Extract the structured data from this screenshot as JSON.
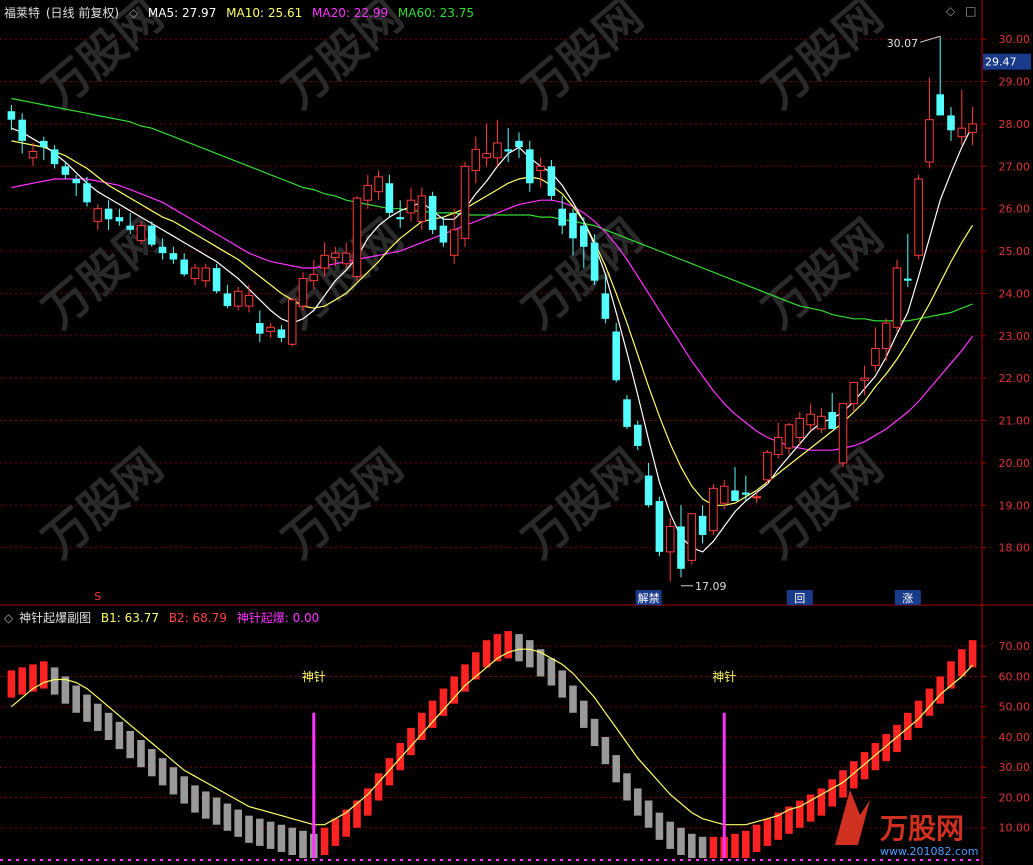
{
  "colors": {
    "background": "#000000",
    "grid": "#7a0000",
    "up": "#ff3b3b",
    "down": "#54ffff",
    "ma5": "#ffffff",
    "ma10": "#ffff66",
    "ma20": "#ff33ff",
    "ma60": "#33dd33",
    "b1": "#ffff66",
    "bar_up": "#ff2222",
    "bar_down": "#999999",
    "needle": "#ff33ff",
    "signal_text": "#ffff66"
  },
  "main_header": {
    "title": "福莱特",
    "mode": "(日线 前复权)",
    "ma5": "MA5: 27.97",
    "ma10": "MA10: 25.61",
    "ma20": "MA20: 22.99",
    "ma60": "MA60: 23.75"
  },
  "sub_header": {
    "title": "神针起爆副图",
    "b1": "B1: 63.77",
    "b2": "B2: 68.79",
    "burst": "神针起爆: 0.00"
  },
  "price_axis": {
    "ticks": [
      "30.00",
      "29.00",
      "28.00",
      "27.00",
      "26.00",
      "25.00",
      "24.00",
      "23.00",
      "22.00",
      "21.00",
      "20.00",
      "19.00",
      "18.00"
    ],
    "current": "29.47"
  },
  "sub_axis": {
    "ticks": [
      "70.00",
      "60.00",
      "50.00",
      "40.00",
      "30.00",
      "20.00",
      "10.00"
    ]
  },
  "annotations": {
    "high": "30.07",
    "low": "17.09",
    "marker_left": "S",
    "tag1": "解禁",
    "tag2": "回",
    "tag3": "涨",
    "needle1": "神针",
    "needle2": "神针"
  },
  "watermark": {
    "brand": "万股网",
    "url": "www.201082.com"
  },
  "chart_data": {
    "type": "candlestick",
    "ohlc": [
      [
        28.3,
        28.45,
        27.85,
        28.1
      ],
      [
        28.1,
        28.25,
        27.3,
        27.6
      ],
      [
        27.2,
        27.55,
        27.0,
        27.35
      ],
      [
        27.6,
        27.7,
        27.15,
        27.45
      ],
      [
        27.4,
        27.5,
        26.95,
        27.05
      ],
      [
        27.0,
        27.1,
        26.7,
        26.8
      ],
      [
        26.7,
        26.8,
        26.3,
        26.6
      ],
      [
        26.6,
        26.75,
        26.05,
        26.15
      ],
      [
        25.7,
        26.1,
        25.5,
        26.0
      ],
      [
        26.0,
        26.2,
        25.5,
        25.75
      ],
      [
        25.8,
        26.0,
        25.6,
        25.7
      ],
      [
        25.6,
        25.9,
        25.4,
        25.5
      ],
      [
        25.25,
        25.7,
        25.15,
        25.6
      ],
      [
        25.6,
        25.7,
        25.1,
        25.15
      ],
      [
        25.1,
        25.3,
        24.8,
        24.95
      ],
      [
        24.95,
        25.1,
        24.7,
        24.8
      ],
      [
        24.8,
        24.95,
        24.4,
        24.45
      ],
      [
        24.35,
        24.7,
        24.2,
        24.6
      ],
      [
        24.3,
        24.7,
        24.15,
        24.6
      ],
      [
        24.6,
        24.7,
        24.0,
        24.05
      ],
      [
        24.0,
        24.2,
        23.65,
        23.7
      ],
      [
        23.7,
        24.15,
        23.6,
        24.05
      ],
      [
        23.7,
        24.2,
        23.55,
        23.95
      ],
      [
        23.3,
        23.6,
        22.85,
        23.05
      ],
      [
        23.1,
        23.3,
        22.95,
        23.2
      ],
      [
        23.15,
        23.25,
        22.85,
        22.95
      ],
      [
        22.8,
        23.9,
        22.75,
        23.85
      ],
      [
        23.7,
        24.5,
        23.6,
        24.35
      ],
      [
        24.3,
        24.8,
        24.1,
        24.45
      ],
      [
        24.6,
        25.2,
        24.4,
        24.9
      ],
      [
        24.85,
        25.1,
        24.65,
        24.95
      ],
      [
        24.7,
        25.2,
        24.6,
        24.95
      ],
      [
        24.4,
        26.3,
        24.3,
        26.25
      ],
      [
        26.2,
        26.8,
        26.0,
        26.55
      ],
      [
        26.4,
        26.9,
        26.2,
        26.75
      ],
      [
        26.6,
        26.8,
        25.8,
        25.9
      ],
      [
        25.8,
        26.2,
        25.55,
        25.75
      ],
      [
        25.9,
        26.5,
        25.7,
        26.2
      ],
      [
        25.7,
        26.5,
        25.5,
        26.3
      ],
      [
        26.3,
        26.4,
        25.4,
        25.5
      ],
      [
        25.6,
        25.8,
        25.1,
        25.2
      ],
      [
        24.9,
        26.0,
        24.7,
        25.5
      ],
      [
        25.3,
        27.1,
        25.1,
        27.0
      ],
      [
        26.9,
        27.7,
        26.6,
        27.4
      ],
      [
        27.2,
        28.0,
        27.0,
        27.3
      ],
      [
        27.2,
        28.1,
        27.0,
        27.55
      ],
      [
        27.4,
        27.9,
        27.1,
        27.35
      ],
      [
        27.6,
        27.8,
        27.2,
        27.45
      ],
      [
        27.4,
        27.6,
        26.4,
        26.6
      ],
      [
        26.9,
        27.2,
        26.5,
        27.0
      ],
      [
        27.0,
        27.15,
        26.2,
        26.3
      ],
      [
        26.0,
        26.3,
        25.4,
        25.6
      ],
      [
        25.9,
        26.0,
        24.9,
        25.3
      ],
      [
        25.6,
        25.8,
        24.6,
        25.1
      ],
      [
        25.2,
        25.4,
        24.2,
        24.3
      ],
      [
        24.0,
        24.4,
        23.3,
        23.4
      ],
      [
        23.1,
        23.3,
        21.9,
        21.95
      ],
      [
        21.5,
        21.6,
        20.8,
        20.85
      ],
      [
        20.9,
        21.0,
        20.3,
        20.4
      ],
      [
        19.7,
        20.0,
        18.95,
        19.0
      ],
      [
        19.1,
        19.2,
        17.8,
        17.9
      ],
      [
        17.9,
        18.7,
        17.2,
        18.5
      ],
      [
        18.5,
        19.0,
        17.3,
        17.5
      ],
      [
        17.7,
        18.8,
        17.6,
        18.8
      ],
      [
        18.75,
        19.0,
        18.1,
        18.3
      ],
      [
        18.4,
        19.5,
        18.3,
        19.4
      ],
      [
        19.05,
        19.6,
        18.9,
        19.45
      ],
      [
        19.35,
        19.9,
        19.1,
        19.1
      ],
      [
        19.3,
        19.7,
        19.1,
        19.25
      ],
      [
        19.2,
        19.3,
        19.05,
        19.2
      ],
      [
        19.6,
        20.3,
        19.5,
        20.25
      ],
      [
        20.2,
        20.95,
        20.1,
        20.6
      ],
      [
        20.35,
        20.95,
        20.2,
        20.9
      ],
      [
        20.6,
        21.2,
        20.4,
        21.05
      ],
      [
        20.9,
        21.4,
        20.75,
        21.15
      ],
      [
        20.8,
        21.3,
        20.7,
        21.1
      ],
      [
        21.2,
        21.65,
        20.8,
        20.8
      ],
      [
        20.0,
        21.4,
        19.9,
        21.4
      ],
      [
        21.4,
        21.9,
        21.2,
        21.9
      ],
      [
        21.95,
        22.3,
        21.6,
        22.0
      ],
      [
        22.3,
        23.2,
        22.15,
        22.7
      ],
      [
        22.7,
        23.4,
        22.4,
        23.3
      ],
      [
        23.2,
        24.8,
        23.1,
        24.6
      ],
      [
        24.35,
        25.4,
        24.15,
        24.3
      ],
      [
        24.9,
        26.8,
        24.8,
        26.7
      ],
      [
        27.1,
        29.1,
        26.95,
        28.1
      ],
      [
        28.7,
        30.07,
        28.5,
        28.2
      ],
      [
        28.2,
        28.4,
        27.6,
        27.85
      ],
      [
        27.7,
        28.8,
        27.5,
        27.9
      ],
      [
        27.8,
        28.4,
        27.5,
        28.0
      ]
    ],
    "ma5": [
      27.9,
      27.8,
      27.65,
      27.5,
      27.3,
      27.1,
      26.85,
      26.6,
      26.4,
      26.25,
      26.1,
      25.95,
      25.8,
      25.65,
      25.5,
      25.35,
      25.2,
      25.05,
      24.9,
      24.75,
      24.55,
      24.35,
      24.1,
      23.85,
      23.6,
      23.4,
      23.3,
      23.4,
      23.6,
      23.95,
      24.3,
      24.55,
      24.85,
      25.3,
      25.6,
      25.8,
      25.95,
      26.05,
      26.15,
      25.95,
      25.75,
      25.75,
      26.0,
      26.35,
      26.65,
      27.0,
      27.3,
      27.45,
      27.2,
      27.0,
      26.85,
      26.55,
      26.15,
      25.7,
      25.15,
      24.45,
      23.55,
      22.6,
      21.6,
      20.55,
      19.55,
      18.8,
      18.25,
      18.0,
      17.9,
      18.15,
      18.5,
      18.85,
      19.1,
      19.3,
      19.5,
      19.85,
      20.15,
      20.45,
      20.75,
      20.95,
      21.05,
      21.2,
      21.45,
      21.75,
      22.05,
      22.5,
      23.05,
      23.55,
      24.4,
      25.3,
      26.2,
      26.85,
      27.45,
      27.97
    ],
    "ma10": [
      27.6,
      27.55,
      27.5,
      27.45,
      27.35,
      27.25,
      27.1,
      26.95,
      26.75,
      26.55,
      26.4,
      26.25,
      26.1,
      25.95,
      25.8,
      25.7,
      25.55,
      25.4,
      25.25,
      25.1,
      24.95,
      24.8,
      24.6,
      24.4,
      24.2,
      24.0,
      23.85,
      23.7,
      23.65,
      23.7,
      23.85,
      24.0,
      24.25,
      24.5,
      24.75,
      25.05,
      25.3,
      25.5,
      25.7,
      25.75,
      25.8,
      25.9,
      26.0,
      26.15,
      26.3,
      26.45,
      26.6,
      26.7,
      26.75,
      26.7,
      26.55,
      26.35,
      26.05,
      25.7,
      25.2,
      24.65,
      24.0,
      23.3,
      22.55,
      21.8,
      21.1,
      20.45,
      19.9,
      19.45,
      19.15,
      19.0,
      19.0,
      19.05,
      19.2,
      19.35,
      19.55,
      19.75,
      19.95,
      20.15,
      20.35,
      20.55,
      20.75,
      20.95,
      21.2,
      21.45,
      21.8,
      22.1,
      22.45,
      22.85,
      23.3,
      23.75,
      24.25,
      24.75,
      25.2,
      25.61
    ],
    "ma20": [
      26.5,
      26.55,
      26.6,
      26.65,
      26.7,
      26.7,
      26.7,
      26.7,
      26.65,
      26.6,
      26.55,
      26.45,
      26.35,
      26.25,
      26.15,
      26.0,
      25.85,
      25.7,
      25.55,
      25.4,
      25.25,
      25.1,
      24.95,
      24.85,
      24.75,
      24.7,
      24.65,
      24.6,
      24.6,
      24.65,
      24.7,
      24.75,
      24.8,
      24.85,
      24.9,
      24.95,
      25.0,
      25.1,
      25.2,
      25.3,
      25.4,
      25.5,
      25.6,
      25.7,
      25.8,
      25.9,
      26.0,
      26.1,
      26.15,
      26.2,
      26.2,
      26.15,
      26.05,
      25.9,
      25.7,
      25.45,
      25.15,
      24.8,
      24.4,
      24.0,
      23.6,
      23.2,
      22.8,
      22.4,
      22.05,
      21.7,
      21.4,
      21.15,
      20.95,
      20.75,
      20.6,
      20.5,
      20.4,
      20.35,
      20.3,
      20.3,
      20.3,
      20.35,
      20.4,
      20.5,
      20.65,
      20.8,
      21.0,
      21.2,
      21.45,
      21.75,
      22.05,
      22.35,
      22.65,
      22.99
    ],
    "ma60": [
      28.6,
      28.55,
      28.5,
      28.45,
      28.4,
      28.35,
      28.3,
      28.25,
      28.2,
      28.15,
      28.1,
      28.05,
      27.95,
      27.9,
      27.8,
      27.7,
      27.6,
      27.5,
      27.4,
      27.3,
      27.2,
      27.1,
      27.0,
      26.9,
      26.8,
      26.7,
      26.6,
      26.5,
      26.45,
      26.35,
      26.3,
      26.2,
      26.15,
      26.1,
      26.05,
      26.0,
      26.0,
      25.95,
      25.95,
      25.9,
      25.9,
      25.9,
      25.85,
      25.85,
      25.85,
      25.85,
      25.85,
      25.85,
      25.85,
      25.8,
      25.8,
      25.75,
      25.7,
      25.65,
      25.6,
      25.5,
      25.4,
      25.3,
      25.2,
      25.1,
      25.0,
      24.9,
      24.8,
      24.7,
      24.6,
      24.5,
      24.4,
      24.3,
      24.2,
      24.1,
      24.0,
      23.9,
      23.8,
      23.7,
      23.65,
      23.6,
      23.5,
      23.45,
      23.4,
      23.4,
      23.35,
      23.35,
      23.35,
      23.35,
      23.4,
      23.45,
      23.5,
      23.55,
      23.65,
      23.75
    ],
    "sub_bars": [
      62,
      63,
      64,
      65,
      63,
      60,
      57,
      54,
      51,
      48,
      45,
      42,
      39,
      36,
      33,
      30,
      27,
      24,
      22,
      20,
      18,
      16,
      14,
      13,
      12,
      11,
      10,
      9,
      8,
      10,
      13,
      16,
      19,
      23,
      28,
      33,
      38,
      43,
      48,
      52,
      56,
      60,
      64,
      68,
      72,
      74,
      75,
      74,
      72,
      69,
      66,
      62,
      57,
      52,
      46,
      40,
      34,
      28,
      23,
      19,
      15,
      12,
      10,
      8,
      7,
      7,
      7,
      8,
      9,
      11,
      13,
      15,
      17,
      19,
      21,
      23,
      26,
      29,
      32,
      35,
      38,
      41,
      44,
      48,
      52,
      56,
      60,
      65,
      69,
      72
    ],
    "b1_line": [
      50,
      53,
      56,
      58,
      59,
      59,
      58,
      56,
      53,
      50,
      47,
      44,
      41,
      38,
      35,
      32,
      29,
      27,
      25,
      23,
      21,
      19,
      17,
      16,
      15,
      14,
      13,
      12,
      11,
      11,
      13,
      15,
      18,
      21,
      25,
      29,
      33,
      37,
      41,
      45,
      49,
      53,
      57,
      60,
      63,
      66,
      68,
      69,
      69,
      68,
      66,
      64,
      61,
      57,
      53,
      48,
      43,
      38,
      33,
      29,
      25,
      21,
      18,
      15,
      13,
      12,
      11,
      11,
      11,
      12,
      13,
      14,
      16,
      17,
      19,
      21,
      23,
      25,
      28,
      31,
      34,
      37,
      40,
      43,
      46,
      50,
      54,
      57,
      60,
      63.77
    ],
    "sub_ylim": [
      0,
      78
    ],
    "price_ylim": [
      17.0,
      30.5
    ]
  }
}
